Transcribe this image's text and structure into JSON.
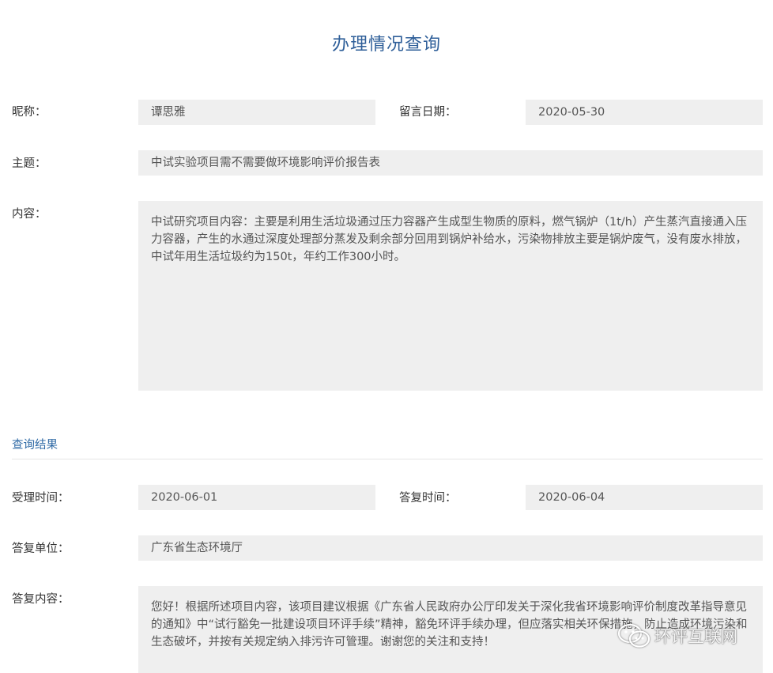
{
  "page": {
    "title": "办理情况查询"
  },
  "inquiry": {
    "nickname_label": "昵称：",
    "nickname_value": "谭思雅",
    "date_label": "留言日期：",
    "date_value": "2020-05-30",
    "subject_label": "主题：",
    "subject_value": "中试实验项目需不需要做环境影响评价报告表",
    "content_label": "内容：",
    "content_value": "中试研究项目内容：主要是利用生活垃圾通过压力容器产生成型生物质的原料，燃气锅炉（1t/h）产生蒸汽直接通入压力容器，产生的水通过深度处理部分蒸发及剩余部分回用到锅炉补给水，污染物排放主要是锅炉废气，没有废水排放，中试年用生活垃圾约为150t，年约工作300小时。"
  },
  "result": {
    "section_title": "查询结果",
    "accept_time_label": "受理时间：",
    "accept_time_value": "2020-06-01",
    "reply_time_label": "答复时间：",
    "reply_time_value": "2020-06-04",
    "reply_unit_label": "答复单位：",
    "reply_unit_value": "广东省生态环境厅",
    "reply_content_label": "答复内容：",
    "reply_content_value": "您好！根据所述项目内容，该项目建议根据《广东省人民政府办公厅印发关于深化我省环境影响评价制度改革指导意见的通知》中“试行豁免一批建设项目环评手续”精神，豁免环评手续办理，但应落实相关环保措施，防止造成环境污染和生态破坏，并按有关规定纳入排污许可管理。谢谢您的关注和支持！"
  },
  "watermark": {
    "text": "环评互联网",
    "icon": "wechat-icon"
  }
}
